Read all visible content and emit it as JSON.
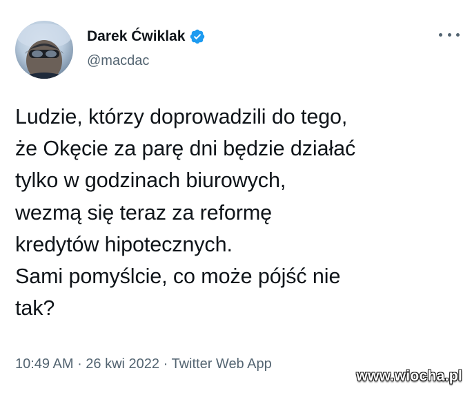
{
  "author": {
    "display_name": "Darek Ćwiklak",
    "handle": "@macdac",
    "verified": true
  },
  "more_icon": "more-horizontal-icon",
  "tweet": {
    "text": "Ludzie, którzy doprowadzili do tego,\nże Okęcie za parę dni będzie działać\ntylko w godzinach biurowych,\nwezmą się teraz za reformę\nkredytów hipotecznych.\nSami pomyślcie, co może pójść nie\ntak?"
  },
  "meta": {
    "time": "10:49 AM",
    "date": "26 kwi 2022",
    "separator": " · ",
    "source": "Twitter Web App"
  },
  "watermark": "www.wiocha.pl",
  "colors": {
    "text": "#0f1419",
    "secondary": "#536471",
    "verified_badge": "#1d9bf0"
  }
}
